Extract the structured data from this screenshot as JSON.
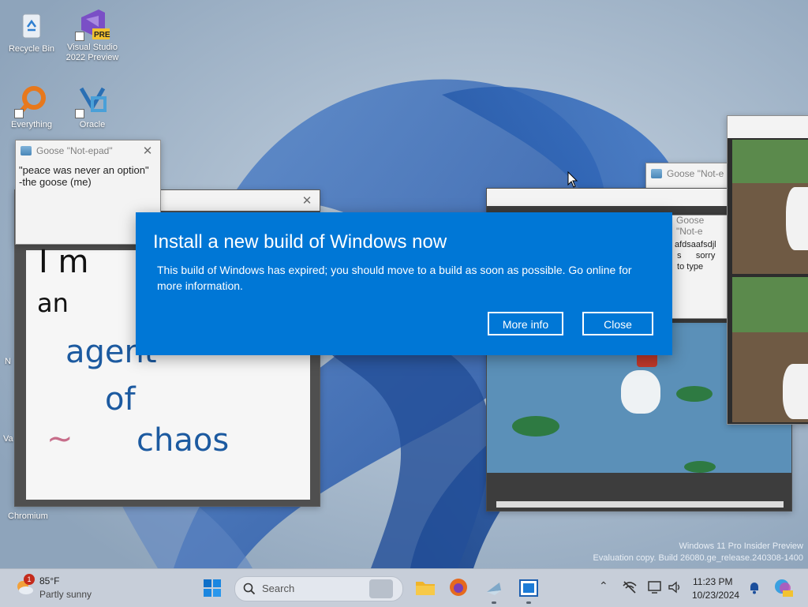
{
  "desktop": {
    "icons": [
      {
        "label": "Recycle Bin"
      },
      {
        "label": "Visual Studio 2022 Preview",
        "badge": "PRE"
      },
      {
        "label": "Everything"
      },
      {
        "label": "Oracle"
      }
    ],
    "partial_labels": [
      "N",
      "Va",
      "Chromium"
    ]
  },
  "windows": {
    "notepad_main": {
      "title": "Goose \"Not-epad\"",
      "text": "\"peace was never an option\"\n  -the goose (me)"
    },
    "notepad_right": {
      "title": "Goose \"Not-e"
    },
    "notepad_right2": {
      "title": "Goose \"Not-e",
      "text": "afdsaafsdjl\n s      sorry\n to type"
    },
    "drawing": {
      "handwriting": [
        "I m",
        "an",
        "agent",
        "of",
        "chaos",
        "~"
      ]
    }
  },
  "dialog": {
    "title": "Install a new build of Windows now",
    "message": "This build of Windows has expired; you should move to a build as soon as possible. Go online for more information.",
    "more_info_label": "More info",
    "close_label": "Close"
  },
  "watermark": {
    "line1": "Windows 11 Pro Insider Preview",
    "line2": "Evaluation copy. Build 26080.ge_release.240308-1400"
  },
  "taskbar": {
    "weather": {
      "temp": "85°F",
      "desc": "Partly sunny",
      "badge": "1"
    },
    "search_label": "Search",
    "clock": {
      "time": "11:23 PM",
      "date": "10/23/2024"
    },
    "colors": {
      "accent": "#0077d6",
      "taskbar": "#c7ced9"
    }
  }
}
